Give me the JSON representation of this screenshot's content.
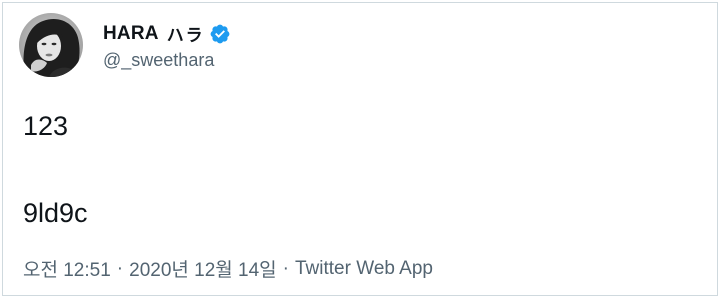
{
  "tweet": {
    "display_name": "HARA",
    "display_name_extra": "ハラ",
    "handle": "@_sweethara",
    "lines": [
      "123",
      "9ld9c"
    ],
    "time": "오전 12:51",
    "date": "2020년 12월 14일",
    "source": "Twitter Web App",
    "separator": "·"
  },
  "icons": {
    "verified": "verified-badge-icon",
    "avatar": "profile-avatar"
  },
  "colors": {
    "verified_blue": "#1d9bf0",
    "text_primary": "#0f1419",
    "text_secondary": "#536471",
    "border": "#cfd9de"
  }
}
